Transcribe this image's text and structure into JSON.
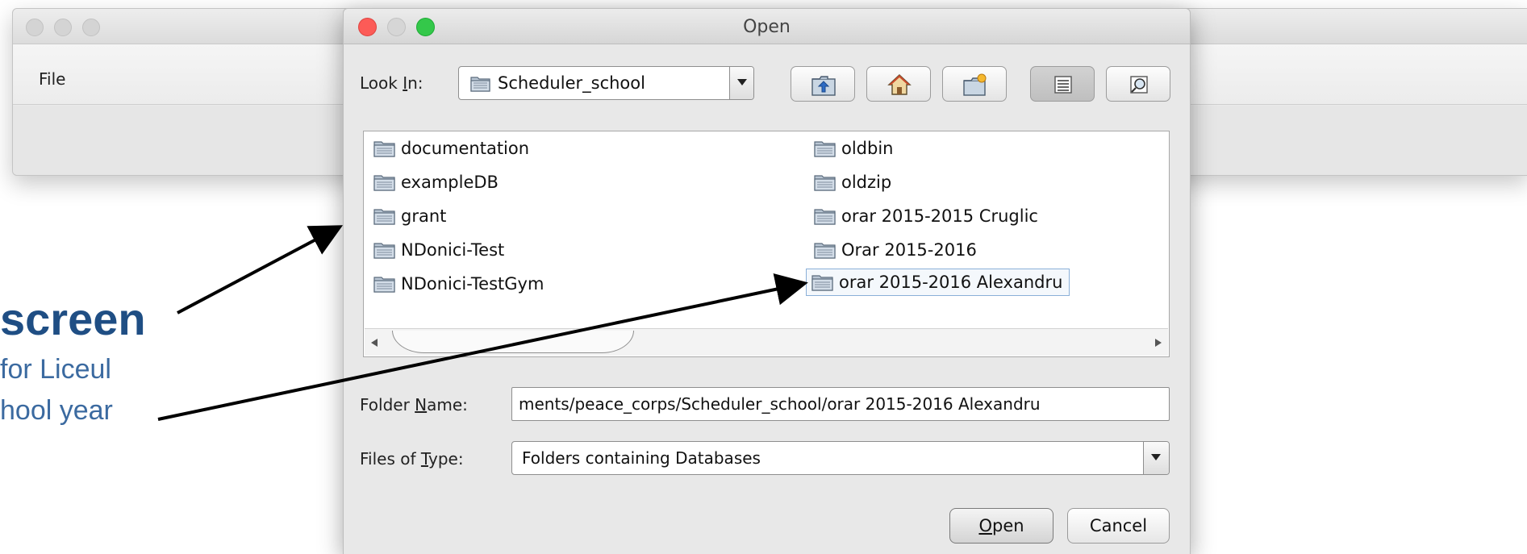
{
  "background_window": {
    "menu": [
      "File"
    ]
  },
  "annotation": {
    "title": "screen",
    "lines": [
      "for Liceul",
      "hool year"
    ]
  },
  "dialog": {
    "title": "Open",
    "look_in": {
      "label_before": "Look ",
      "label_mnemonic": "I",
      "label_after": "n:",
      "value": "Scheduler_school"
    },
    "toolbar": [
      {
        "name": "up-one-level",
        "icon": "folder-up-icon"
      },
      {
        "name": "home",
        "icon": "home-icon"
      },
      {
        "name": "create-new-folder",
        "icon": "new-folder-icon"
      },
      {
        "name": "list-view",
        "icon": "list-icon",
        "pressed": true
      },
      {
        "name": "details-view",
        "icon": "details-icon"
      }
    ],
    "files": {
      "column1": [
        "documentation",
        "exampleDB",
        "grant",
        "NDonici-Test",
        "NDonici-TestGym"
      ],
      "column2": [
        "oldbin",
        "oldzip",
        "orar 2015-2015 Cruglic",
        "Orar 2015-2016",
        "orar 2015-2016 Alexandru"
      ],
      "selected": "orar 2015-2016 Alexandru"
    },
    "folder_name": {
      "label_before": "Folder ",
      "label_mnemonic": "N",
      "label_after": "ame:",
      "value": "ments/peace_corps/Scheduler_school/orar 2015-2016 Alexandru"
    },
    "files_of_type": {
      "label_before": "Files of ",
      "label_mnemonic": "T",
      "label_after": "ype:",
      "value": "Folders containing Databases"
    },
    "buttons": {
      "open_mnemonic": "O",
      "open_rest": "pen",
      "cancel": "Cancel"
    }
  },
  "colors": {
    "annotation_title": "#1f4e84",
    "annotation_text": "#3b6aa0",
    "close_light": "#fc5b57",
    "maximize_light": "#34c84a",
    "selection_border": "#8ab0d8"
  }
}
